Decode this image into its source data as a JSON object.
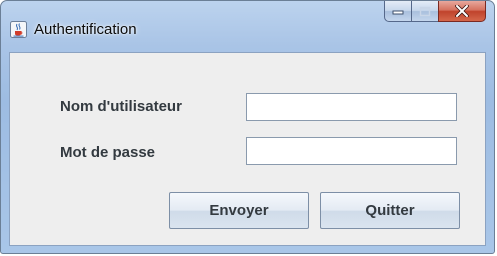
{
  "window": {
    "title": "Authentification",
    "icons": {
      "app": "java-cup-icon",
      "minimize": "minimize-icon",
      "maximize": "maximize-icon",
      "close": "close-icon"
    }
  },
  "form": {
    "username": {
      "label": "Nom d'utilisateur",
      "value": ""
    },
    "password": {
      "label": "Mot de passe",
      "value": ""
    }
  },
  "buttons": {
    "send": "Envoyer",
    "quit": "Quitter"
  },
  "colors": {
    "close_button": "#c0432c",
    "client_background": "#eeeeee",
    "frame": "#a9c4e6"
  }
}
